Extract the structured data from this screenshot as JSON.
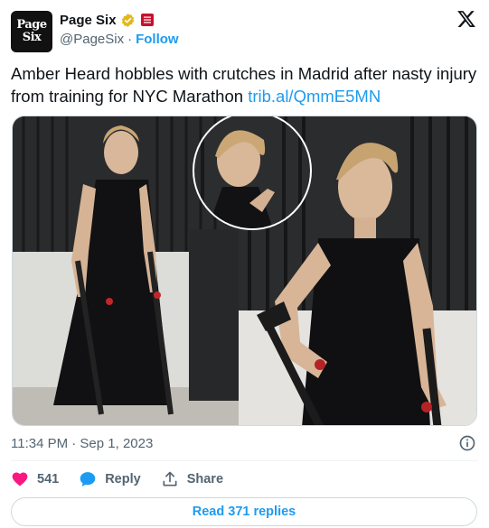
{
  "account": {
    "avatar_text_line1": "Page",
    "avatar_text_line2": "Six",
    "display_name": "Page Six",
    "handle": "@PageSix",
    "separator": "·",
    "follow_label": "Follow"
  },
  "tweet": {
    "text": "Amber Heard hobbles with crutches in Madrid after nasty injury from training for NYC Marathon ",
    "link": "trib.al/QmmE5MN",
    "timestamp": "11:34 PM · Sep 1, 2023"
  },
  "actions": {
    "like_count": "541",
    "reply_label": "Reply",
    "share_label": "Share"
  },
  "read_replies_label": "Read 371 replies",
  "colors": {
    "accent": "#1d9bf0",
    "like": "#f91880",
    "verified": "#e2b719",
    "affiliation": "#c8102e",
    "text_primary": "#0f1419",
    "text_secondary": "#536471"
  },
  "icons": {
    "brand": "x-logo-icon",
    "verified": "verified-badge-icon",
    "affiliation": "affiliation-badge-icon",
    "info": "info-icon",
    "like": "heart-icon",
    "reply": "speech-bubble-icon",
    "share": "share-arrow-icon"
  }
}
